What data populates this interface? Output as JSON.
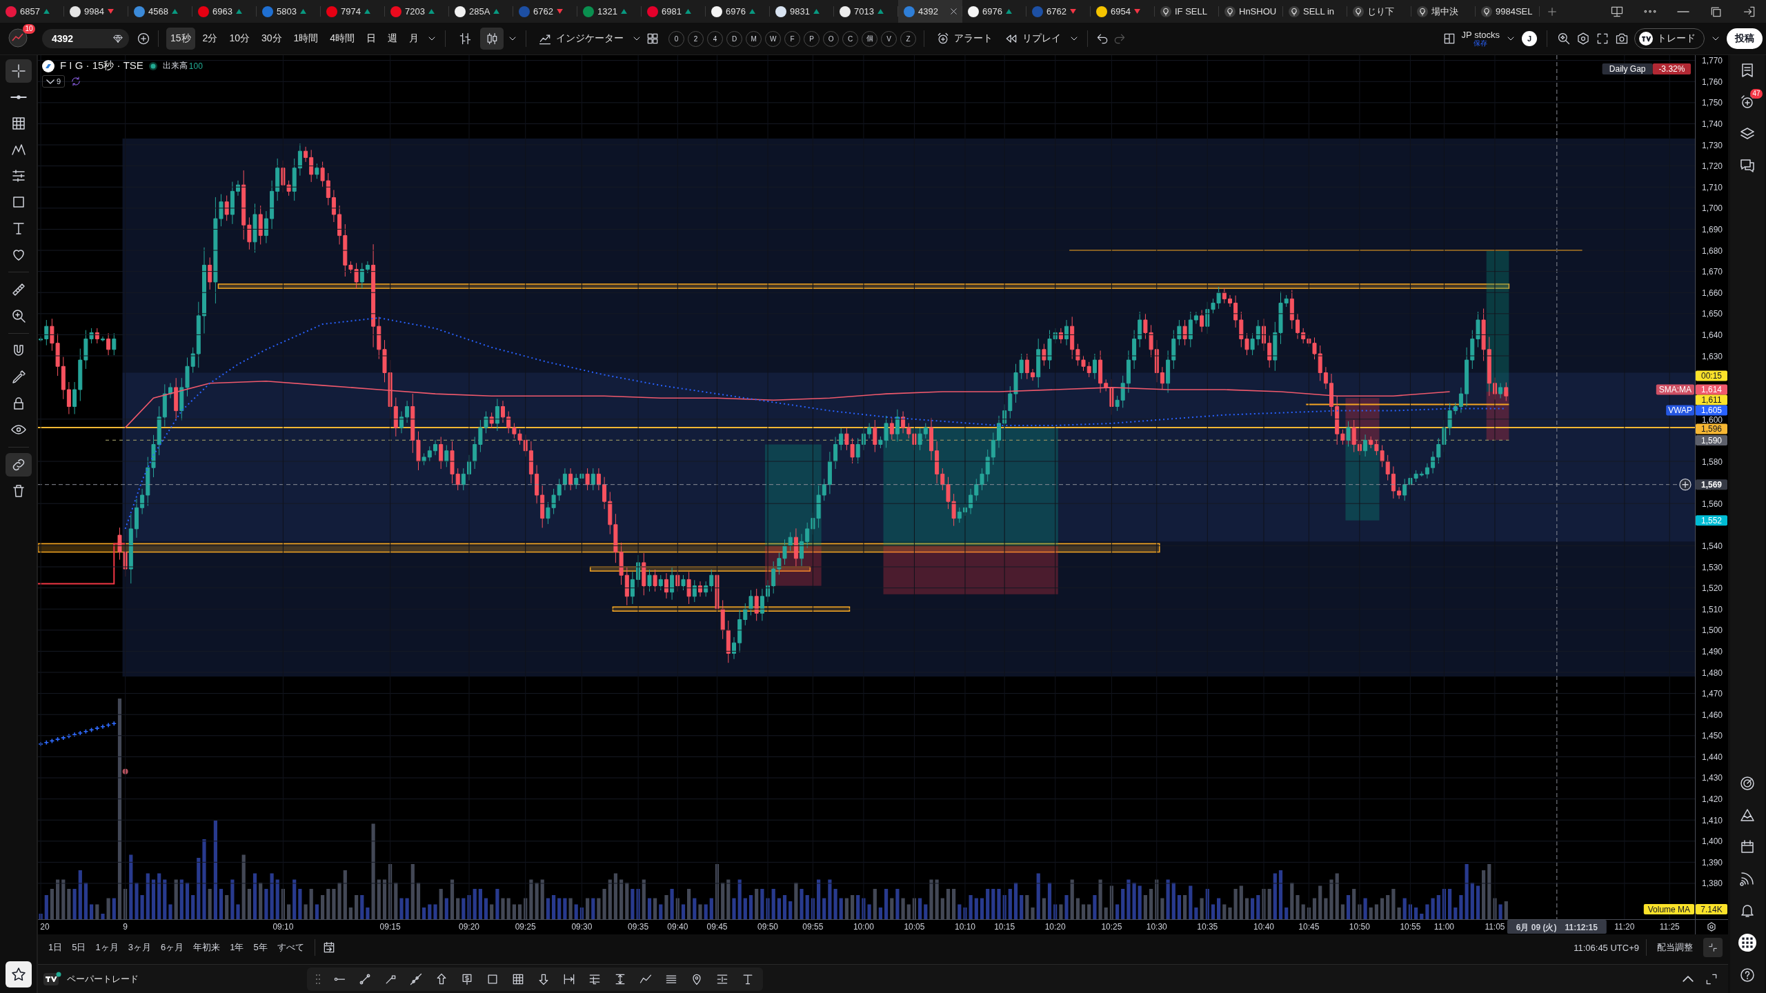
{
  "tabs": [
    {
      "kind": "symbol",
      "label": "6857",
      "color": "#e5173f",
      "rising": true,
      "selected": false
    },
    {
      "kind": "symbol",
      "label": "9984",
      "color": "#e6e6e6",
      "rising": false,
      "selected": false
    },
    {
      "kind": "symbol",
      "label": "4568",
      "color": "#3b8ad9",
      "rising": true,
      "selected": false
    },
    {
      "kind": "symbol",
      "label": "6963",
      "color": "#e60012",
      "rising": true,
      "selected": false
    },
    {
      "kind": "symbol",
      "label": "5803",
      "color": "#1f6fd1",
      "rising": true,
      "selected": false
    },
    {
      "kind": "symbol",
      "label": "7974",
      "color": "#e60013",
      "rising": true,
      "selected": false
    },
    {
      "kind": "symbol",
      "label": "7203",
      "color": "#eb0a1e",
      "rising": true,
      "selected": false
    },
    {
      "kind": "symbol",
      "label": "285A",
      "color": "#f2f2f2",
      "rising": true,
      "selected": false
    },
    {
      "kind": "symbol",
      "label": "6762",
      "color": "#1d4fa3",
      "rising": false,
      "selected": false
    },
    {
      "kind": "symbol",
      "label": "1321",
      "color": "#0a8f4f",
      "rising": true,
      "selected": false
    },
    {
      "kind": "symbol",
      "label": "6981",
      "color": "#e4002b",
      "rising": true,
      "selected": false
    },
    {
      "kind": "symbol",
      "label": "6976",
      "color": "#f4f4f4",
      "rising": true,
      "selected": false
    },
    {
      "kind": "symbol",
      "label": "9831",
      "color": "#d9e4f2",
      "rising": true,
      "selected": false
    },
    {
      "kind": "symbol",
      "label": "7013",
      "color": "#eeeeee",
      "rising": true,
      "selected": false
    },
    {
      "kind": "symbol",
      "label": "4392",
      "color": "#2f7fd8",
      "selected": true
    },
    {
      "kind": "symbol",
      "label": "6976",
      "color": "#f5f5f5",
      "rising": true,
      "selected": false
    },
    {
      "kind": "symbol",
      "label": "6762",
      "color": "#1d50a4",
      "rising": false,
      "selected": false
    },
    {
      "kind": "symbol",
      "label": "6954",
      "color": "#f5c400",
      "rising": false,
      "selected": false
    },
    {
      "kind": "alert",
      "label": "IF SELL",
      "selected": false
    },
    {
      "kind": "alert",
      "label": "HnSHOU",
      "selected": false
    },
    {
      "kind": "alert",
      "label": "SELL in",
      "selected": false
    },
    {
      "kind": "alert",
      "label": "じり下",
      "selected": false
    },
    {
      "kind": "alert",
      "label": "場中決",
      "selected": false
    },
    {
      "kind": "alert",
      "label": "9984SEL",
      "selected": false
    }
  ],
  "toolbar": {
    "profile_badge": "10",
    "symbol": "4392",
    "intervals": [
      {
        "label": "15秒",
        "selected": true
      },
      {
        "label": "2分",
        "selected": false
      },
      {
        "label": "10分",
        "selected": false
      },
      {
        "label": "30分",
        "selected": false
      },
      {
        "label": "1時間",
        "selected": false
      },
      {
        "label": "4時間",
        "selected": false
      },
      {
        "label": "日",
        "selected": false
      },
      {
        "label": "週",
        "selected": false
      },
      {
        "label": "月",
        "selected": false
      }
    ],
    "chart_styles": [
      {
        "selected": false
      },
      {
        "selected": true
      }
    ],
    "indicators": "インジケーター",
    "scripts": [
      "0",
      "2",
      "4",
      "D",
      "M",
      "W",
      "F",
      "P",
      "O",
      "C",
      "個",
      "V",
      "Z"
    ],
    "alert": "アラート",
    "replay": "リプレイ",
    "layout_name": "JP stocks",
    "layout_status": "保存",
    "account_initial": "J",
    "trade": "トレード",
    "publish": "投稿"
  },
  "left_toolbar": [
    {
      "selected": true
    },
    {
      "selected": false
    },
    {
      "selected": false
    },
    {
      "selected": false
    },
    {
      "selected": false
    },
    {
      "selected": false
    },
    {
      "selected": false
    },
    {
      "selected": false
    },
    {
      "selected": false
    },
    {
      "selected": false
    },
    {
      "selected": false
    },
    {
      "selected": false
    },
    {
      "selected": false
    },
    {
      "selected": false
    },
    {
      "selected": true
    },
    {
      "selected": false
    }
  ],
  "legend": {
    "title": "F I G · 15秒 · TSE",
    "market_open": true,
    "indicator": "出来高",
    "indicator_value": "100",
    "hidden_count": "9"
  },
  "price_axis": {
    "tags": [
      {
        "kind": "countdown",
        "label": "00:15",
        "color": "#fbe22a"
      },
      {
        "kind": "price",
        "title": "SMA:MA",
        "label": "1,614",
        "color": "#f0596c"
      },
      {
        "kind": "price",
        "label": "1,611",
        "color": "#fbe22b"
      },
      {
        "kind": "price",
        "title": "VWAP",
        "label": "1,605",
        "color": "#2962ff"
      },
      {
        "kind": "price",
        "label": "1,596",
        "color": "#f7b733"
      },
      {
        "kind": "price",
        "label": "1,590",
        "color": "#5d606b"
      },
      {
        "kind": "crosshair",
        "label": "1,569"
      },
      {
        "kind": "price",
        "label": "1,552",
        "color": "#00bcd4"
      }
    ]
  },
  "chart": {
    "daily_gap": {
      "label": "Daily Gap",
      "value": "-3.32%"
    },
    "volume_ma": {
      "label": "Volume MA",
      "value": "7.14K"
    },
    "crosshair_time": {
      "date": "6月 09 (火)",
      "time": "11:12:15"
    },
    "chart_data": {
      "type": "line",
      "grid": true,
      "ylim": [
        1363,
        1772.5
      ],
      "categories": [
        "20",
        null,
        null,
        null,
        null,
        null,
        null,
        null,
        null,
        null,
        null,
        null,
        null,
        null,
        null,
        "9",
        null,
        null,
        null,
        null,
        null,
        null,
        null,
        null,
        null,
        null,
        null,
        null,
        null,
        null,
        null,
        null,
        null,
        null,
        null,
        null,
        null,
        null,
        null,
        null,
        null,
        null,
        null,
        "09:10",
        null,
        null,
        null,
        null,
        null,
        null,
        null,
        null,
        null,
        null,
        null,
        null,
        null,
        null,
        null,
        null,
        null,
        null,
        "09:15",
        null,
        null,
        null,
        null,
        null,
        null,
        null,
        null,
        null,
        null,
        null,
        null,
        null,
        "09:20",
        null,
        null,
        null,
        null,
        null,
        null,
        null,
        null,
        null,
        "09:25",
        null,
        null,
        null,
        null,
        null,
        null,
        null,
        null,
        null,
        "09:30",
        null,
        null,
        null,
        null,
        null,
        null,
        null,
        null,
        null,
        "09:35",
        null,
        null,
        null,
        null,
        null,
        null,
        "09:40",
        null,
        null,
        null,
        null,
        null,
        null,
        "09:45",
        null,
        null,
        null,
        null,
        null,
        null,
        null,
        null,
        "09:50",
        null,
        null,
        null,
        null,
        null,
        null,
        null,
        "09:55",
        null,
        null,
        null,
        null,
        null,
        null,
        null,
        null,
        "10:00",
        null,
        null,
        null,
        null,
        null,
        null,
        null,
        null,
        "10:05",
        null,
        null,
        null,
        null,
        null,
        null,
        null,
        null,
        "10:10",
        null,
        null,
        null,
        null,
        null,
        null,
        "10:15",
        null,
        null,
        null,
        null,
        null,
        null,
        null,
        null,
        "10:20",
        null,
        null,
        null,
        null,
        null,
        null,
        null,
        null,
        null,
        "10:25",
        null,
        null,
        null,
        null,
        null,
        null,
        null,
        "10:30",
        null,
        null,
        null,
        null,
        null,
        null,
        null,
        null,
        "10:35",
        null,
        null,
        null,
        null,
        null,
        null,
        null,
        null,
        null,
        "10:40",
        null,
        null,
        null,
        null,
        null,
        null,
        null,
        "10:45",
        null,
        null,
        null,
        null,
        null,
        null,
        null,
        null,
        "10:50",
        null,
        null,
        null,
        null,
        null,
        null,
        null,
        null,
        "10:55",
        null,
        null,
        null,
        null,
        null,
        "11:00",
        null,
        null,
        null,
        null,
        null,
        null,
        null,
        null,
        "11:05",
        null,
        null,
        null,
        null,
        null,
        null,
        null,
        null,
        null,
        null,
        null,
        null,
        null,
        null,
        null,
        null,
        null,
        null,
        null,
        null,
        null,
        null,
        "11:20",
        null,
        null,
        null,
        null,
        null,
        null,
        null,
        "11:25",
        null,
        null,
        null,
        null
      ],
      "yticks": [
        {
          "value": 1770,
          "label": "1,770"
        },
        {
          "value": 1760,
          "label": "1,760"
        },
        {
          "value": 1750,
          "label": "1,750"
        },
        {
          "value": 1740,
          "label": "1,740"
        },
        {
          "value": 1730,
          "label": "1,730"
        },
        {
          "value": 1720,
          "label": "1,720"
        },
        {
          "value": 1710,
          "label": "1,710"
        },
        {
          "value": 1700,
          "label": "1,700"
        },
        {
          "value": 1690,
          "label": "1,690"
        },
        {
          "value": 1680,
          "label": "1,680"
        },
        {
          "value": 1670,
          "label": "1,670"
        },
        {
          "value": 1660,
          "label": "1,660"
        },
        {
          "value": 1650,
          "label": "1,650"
        },
        {
          "value": 1640,
          "label": "1,640"
        },
        {
          "value": 1630,
          "label": "1,630"
        },
        {
          "value": 1600,
          "label": "1,600"
        },
        {
          "value": 1580,
          "label": "1,580"
        },
        {
          "value": 1560,
          "label": "1,560"
        },
        {
          "value": 1540,
          "label": "1,540"
        },
        {
          "value": 1530,
          "label": "1,530"
        },
        {
          "value": 1520,
          "label": "1,520"
        },
        {
          "value": 1510,
          "label": "1,510"
        },
        {
          "value": 1500,
          "label": "1,500"
        },
        {
          "value": 1490,
          "label": "1,490"
        },
        {
          "value": 1480,
          "label": "1,480"
        },
        {
          "value": 1470,
          "label": "1,470"
        },
        {
          "value": 1460,
          "label": "1,460"
        },
        {
          "value": 1450,
          "label": "1,450"
        },
        {
          "value": 1440,
          "label": "1,440"
        },
        {
          "value": 1430,
          "label": "1,430"
        },
        {
          "value": 1420,
          "label": "1,420"
        },
        {
          "value": 1410,
          "label": "1,410"
        },
        {
          "value": 1400,
          "label": "1,400"
        },
        {
          "value": 1390,
          "label": "1,390"
        },
        {
          "value": 1380,
          "label": "1,380"
        }
      ],
      "series": [
        {
          "color": "#f0596c",
          "values": [
            null,
            null,
            null,
            null,
            null,
            null,
            null,
            null,
            null,
            null,
            null,
            null,
            null,
            null,
            null,
            1596,
            null,
            null,
            null,
            null,
            1610,
            null,
            null,
            null,
            null,
            null,
            null,
            null,
            null,
            null,
            1617,
            null,
            null,
            null,
            null,
            null,
            null,
            null,
            null,
            null,
            1618,
            null,
            null,
            null,
            null,
            null,
            null,
            null,
            null,
            null,
            1616,
            null,
            null,
            null,
            null,
            null,
            null,
            null,
            null,
            null,
            1614,
            null,
            null,
            null,
            null,
            null,
            null,
            null,
            null,
            null,
            1612,
            null,
            null,
            null,
            null,
            null,
            null,
            null,
            null,
            null,
            1611,
            null,
            null,
            null,
            null,
            null,
            null,
            null,
            null,
            null,
            1611,
            null,
            null,
            null,
            null,
            null,
            null,
            null,
            null,
            null,
            1611,
            null,
            null,
            null,
            null,
            null,
            null,
            null,
            null,
            null,
            1610,
            null,
            null,
            null,
            null,
            null,
            null,
            null,
            null,
            null,
            1610,
            null,
            null,
            null,
            null,
            null,
            null,
            null,
            null,
            null,
            1609,
            null,
            null,
            null,
            null,
            null,
            null,
            null,
            null,
            null,
            1610,
            null,
            null,
            null,
            null,
            null,
            null,
            null,
            null,
            null,
            1612,
            null,
            null,
            null,
            null,
            null,
            null,
            null,
            null,
            null,
            1613,
            null,
            null,
            null,
            null,
            null,
            null,
            null,
            null,
            null,
            1613,
            null,
            null,
            null,
            null,
            null,
            null,
            null,
            null,
            null,
            1614,
            null,
            null,
            null,
            null,
            null,
            null,
            null,
            null,
            null,
            1615,
            null,
            null,
            null,
            null,
            null,
            null,
            null,
            null,
            null,
            1614,
            null,
            null,
            null,
            null,
            null,
            null,
            null,
            null,
            null,
            1614,
            null,
            null,
            null,
            null,
            null,
            null,
            null,
            null,
            null,
            1613,
            null,
            null,
            null,
            null,
            null,
            null,
            null,
            null,
            null,
            1611,
            null,
            null,
            null,
            null,
            null,
            null,
            null,
            null,
            null,
            1611,
            null,
            null,
            null,
            null,
            null,
            null,
            null,
            null,
            null,
            1613,
            null,
            null,
            null,
            null,
            null,
            null,
            null,
            null,
            null,
            null,
            null,
            null,
            null,
            null,
            null,
            null,
            null,
            null,
            null,
            null,
            null,
            null,
            null,
            null,
            null,
            null,
            null,
            null,
            null,
            null,
            null,
            null,
            null,
            null,
            null,
            null,
            null,
            null,
            null,
            null,
            null,
            null,
            null
          ]
        },
        {
          "color": "#2962ff",
          "line_style": "dotted",
          "values": [
            null,
            null,
            null,
            null,
            null,
            null,
            null,
            null,
            null,
            null,
            null,
            null,
            null,
            null,
            null,
            1548,
            null,
            null,
            1571,
            null,
            1583,
            null,
            null,
            null,
            null,
            1604,
            null,
            null,
            null,
            null,
            1617,
            null,
            null,
            null,
            null,
            1626,
            null,
            null,
            null,
            null,
            1633,
            null,
            null,
            null,
            null,
            1639,
            null,
            null,
            null,
            null,
            1645,
            null,
            null,
            null,
            null,
            null,
            null,
            null,
            null,
            null,
            1648,
            null,
            null,
            null,
            null,
            null,
            null,
            null,
            null,
            null,
            1643,
            null,
            null,
            null,
            null,
            null,
            null,
            null,
            null,
            null,
            1634,
            null,
            null,
            null,
            null,
            null,
            null,
            null,
            null,
            null,
            1627,
            null,
            null,
            null,
            null,
            null,
            null,
            null,
            null,
            null,
            1621,
            null,
            null,
            null,
            null,
            null,
            null,
            null,
            null,
            null,
            1616,
            null,
            null,
            null,
            null,
            null,
            null,
            null,
            null,
            null,
            1612,
            null,
            null,
            null,
            null,
            null,
            null,
            null,
            null,
            null,
            1608,
            null,
            null,
            null,
            null,
            null,
            null,
            null,
            null,
            null,
            1604,
            null,
            null,
            null,
            null,
            null,
            null,
            null,
            null,
            null,
            1601,
            null,
            null,
            null,
            null,
            null,
            null,
            null,
            null,
            null,
            1599,
            null,
            null,
            null,
            null,
            null,
            null,
            null,
            null,
            null,
            1597,
            null,
            null,
            null,
            null,
            null,
            null,
            null,
            null,
            null,
            1597,
            null,
            null,
            null,
            null,
            null,
            null,
            null,
            null,
            null,
            1598,
            null,
            null,
            null,
            null,
            null,
            null,
            null,
            null,
            null,
            1600,
            null,
            null,
            null,
            null,
            null,
            null,
            null,
            null,
            null,
            1602,
            null,
            null,
            null,
            null,
            null,
            null,
            null,
            null,
            null,
            1603,
            null,
            null,
            null,
            null,
            null,
            null,
            null,
            null,
            null,
            1604,
            null,
            null,
            null,
            null,
            null,
            null,
            null,
            null,
            null,
            1604,
            null,
            null,
            null,
            null,
            null,
            null,
            null,
            null,
            null,
            1605,
            null,
            null,
            null,
            null,
            null,
            null,
            null,
            null,
            null,
            1605,
            null,
            null,
            null,
            null,
            null,
            null,
            null,
            null,
            null,
            null,
            null,
            null,
            null,
            null,
            null,
            null,
            null,
            null,
            null,
            null,
            null,
            null,
            null,
            null,
            null,
            null,
            null,
            null,
            null,
            null,
            null,
            null,
            null
          ]
        }
      ]
    }
  },
  "range_bar": {
    "ranges": [
      "1日",
      "5日",
      "1ヶ月",
      "3ヶ月",
      "6ヶ月",
      "年初来",
      "1年",
      "5年",
      "すべて"
    ],
    "clock": "11:06:45 UTC+9",
    "adjustment": "配当調整"
  },
  "bottom_panel": {
    "title": "ペーパートレード"
  },
  "right_sidebar": {
    "alert_badge": "47"
  }
}
